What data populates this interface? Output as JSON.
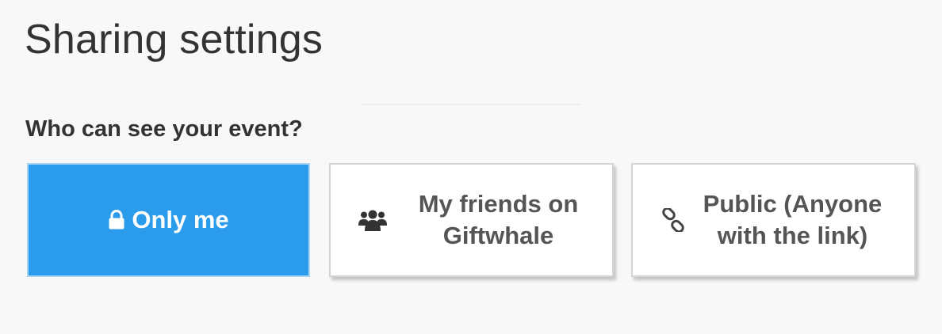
{
  "header": {
    "title": "Sharing settings"
  },
  "visibility": {
    "question": "Who can see your event?",
    "selected": "only_me",
    "options": [
      {
        "id": "only_me",
        "icon": "lock-icon",
        "label": "Only me"
      },
      {
        "id": "friends",
        "icon": "users-icon",
        "label": "My friends on Giftwhale"
      },
      {
        "id": "public",
        "icon": "link-icon",
        "label": "Public (Anyone with the link)"
      }
    ]
  },
  "colors": {
    "accent": "#2b9ceb",
    "text": "#333333",
    "option_text": "#555555",
    "background": "#f8f8f8"
  }
}
